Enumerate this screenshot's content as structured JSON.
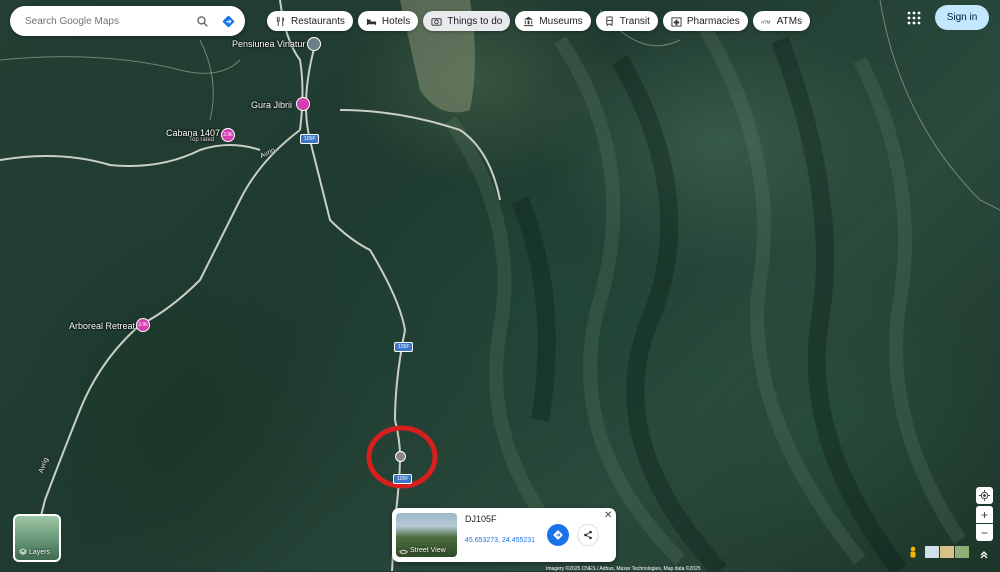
{
  "search": {
    "placeholder": "Search Google Maps",
    "search_icon": "search-icon",
    "directions_icon": "directions-icon"
  },
  "chips": [
    {
      "label": "Restaurants",
      "icon": "fork-knife-icon"
    },
    {
      "label": "Hotels",
      "icon": "bed-icon"
    },
    {
      "label": "Things to do",
      "icon": "camera-icon"
    },
    {
      "label": "Museums",
      "icon": "museum-icon"
    },
    {
      "label": "Transit",
      "icon": "train-icon"
    },
    {
      "label": "Pharmacies",
      "icon": "pharmacy-icon"
    },
    {
      "label": "ATMs",
      "icon": "atm-icon"
    }
  ],
  "header": {
    "signin_label": "Sign in",
    "apps_icon": "apps-grid-icon"
  },
  "places": {
    "pensiunea": "Pensiunea Vinatur",
    "gura": "Gura Jibrii",
    "cabana": "Cabana 1407",
    "cabana_sub": "Top rated",
    "arboreal": "Arboreal Retreat"
  },
  "pin_badge": "3.9k",
  "road_labels": {
    "route": "105F",
    "dj": "DJ105F",
    "name": "Avrig"
  },
  "layers": {
    "label": "Layers",
    "icon": "layers-icon"
  },
  "controls": {
    "locate_icon": "my-location-icon",
    "zoom_in": "+",
    "zoom_out": "−",
    "expand_icon": "chevron-up-double-icon"
  },
  "card": {
    "title": "DJ105F",
    "coords": "45.653273, 24.455231",
    "street_view_label": "Street View",
    "close": "✕"
  },
  "footer": {
    "attribution": "Imagery ©2025 CNES / Airbus, Maxar Technologies, Map data ©2025"
  },
  "colors": {
    "accent": "#1a73e8",
    "signin_bg": "#c2e7ff",
    "pin_pink": "#d33fb0",
    "marker_red": "#d81f1f",
    "road_badge": "#3b76c9"
  }
}
